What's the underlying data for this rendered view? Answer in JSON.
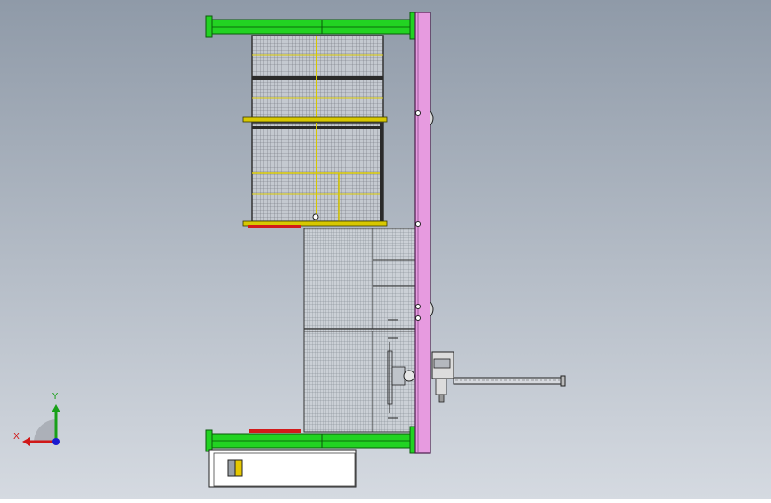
{
  "viewport": {
    "background_top": "#8f9aa8",
    "background_bottom": "#d4d9e0",
    "model_colors": {
      "beam_green": "#22d322",
      "column_pink": "#e79be0",
      "cage_yellow": "#d8c800",
      "red_strip": "#d21a1a",
      "mesh_grey": "#c6cbd2"
    }
  },
  "triad": {
    "x_label": "X",
    "y_label": "Y",
    "x_color": "#d01818",
    "y_color": "#18a018",
    "z_color": "#1a1ad0"
  },
  "title_block": {
    "swatch_colors": [
      "#9aa0a6",
      "#e6c800"
    ]
  }
}
